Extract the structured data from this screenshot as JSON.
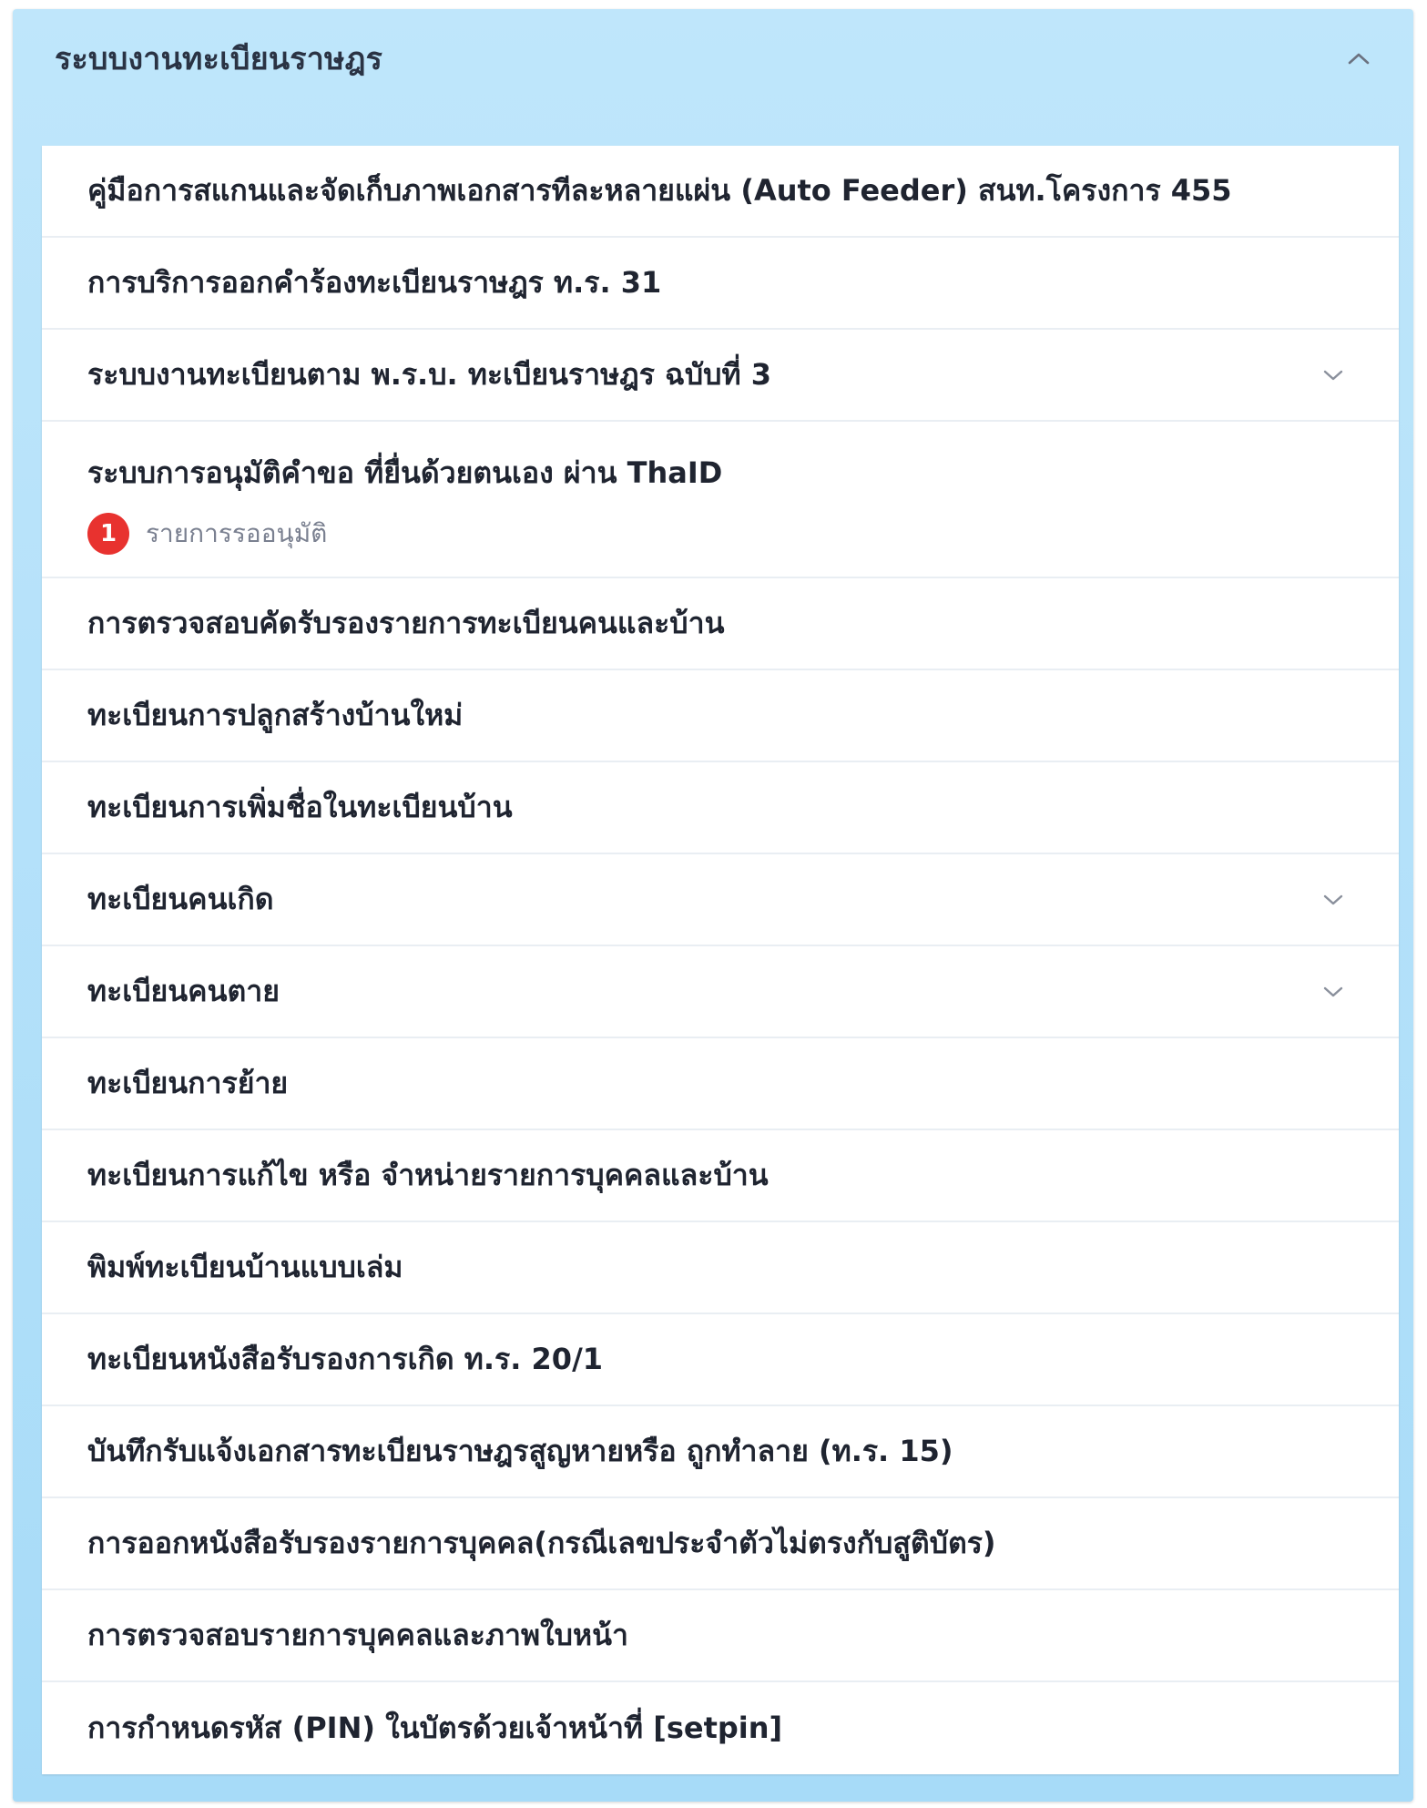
{
  "panel": {
    "title": "ระบบงานทะเบียนราษฎร",
    "collapse_icon": "chevron-up-icon"
  },
  "items": [
    {
      "label": "คู่มือการสแกนและจัดเก็บภาพเอกสารทีละหลายแผ่น (Auto Feeder) สนท.โครงการ 455"
    },
    {
      "label": "การบริการออกคำร้องทะเบียนราษฎร ท.ร. 31"
    },
    {
      "label": "ระบบงานทะเบียนตาม พ.ร.บ. ทะเบียนราษฎร ฉบับที่ 3",
      "expand_icon": "chevron-down-icon"
    },
    {
      "label": "ระบบการอนุมัติคำขอ ที่ยื่นด้วยตนเอง ผ่าน ThaID",
      "badge_count": "1",
      "badge_text": "รายการรออนุมัติ"
    },
    {
      "label": "การตรวจสอบคัดรับรองรายการทะเบียนคนและบ้าน"
    },
    {
      "label": "ทะเบียนการปลูกสร้างบ้านใหม่"
    },
    {
      "label": "ทะเบียนการเพิ่มชื่อในทะเบียนบ้าน"
    },
    {
      "label": "ทะเบียนคนเกิด",
      "expand_icon": "chevron-down-icon"
    },
    {
      "label": "ทะเบียนคนตาย",
      "expand_icon": "chevron-down-icon"
    },
    {
      "label": "ทะเบียนการย้าย"
    },
    {
      "label": "ทะเบียนการแก้ไข หรือ จำหน่ายรายการบุคคลและบ้าน"
    },
    {
      "label": "พิมพ์ทะเบียนบ้านแบบเล่ม"
    },
    {
      "label": "ทะเบียนหนังสือรับรองการเกิด ท.ร. 20/1"
    },
    {
      "label": "บันทึกรับแจ้งเอกสารทะเบียนราษฎรสูญหายหรือ ถูกทำลาย (ท.ร. 15)"
    },
    {
      "label": "การออกหนังสือรับรองรายการบุคคล(กรณีเลขประจำตัวไม่ตรงกับสูติบัตร)"
    },
    {
      "label": "การตรวจสอบรายการบุคคลและภาพใบหน้า"
    },
    {
      "label": "การกำหนดรหัส (PIN) ในบัตรด้วยเจ้าหน้าที่ [setpin]"
    }
  ],
  "colors": {
    "panel_bg": "#a7dbf8",
    "badge_bg": "#e8322f",
    "text": "#1f2430",
    "muted_text": "#7a8090"
  }
}
